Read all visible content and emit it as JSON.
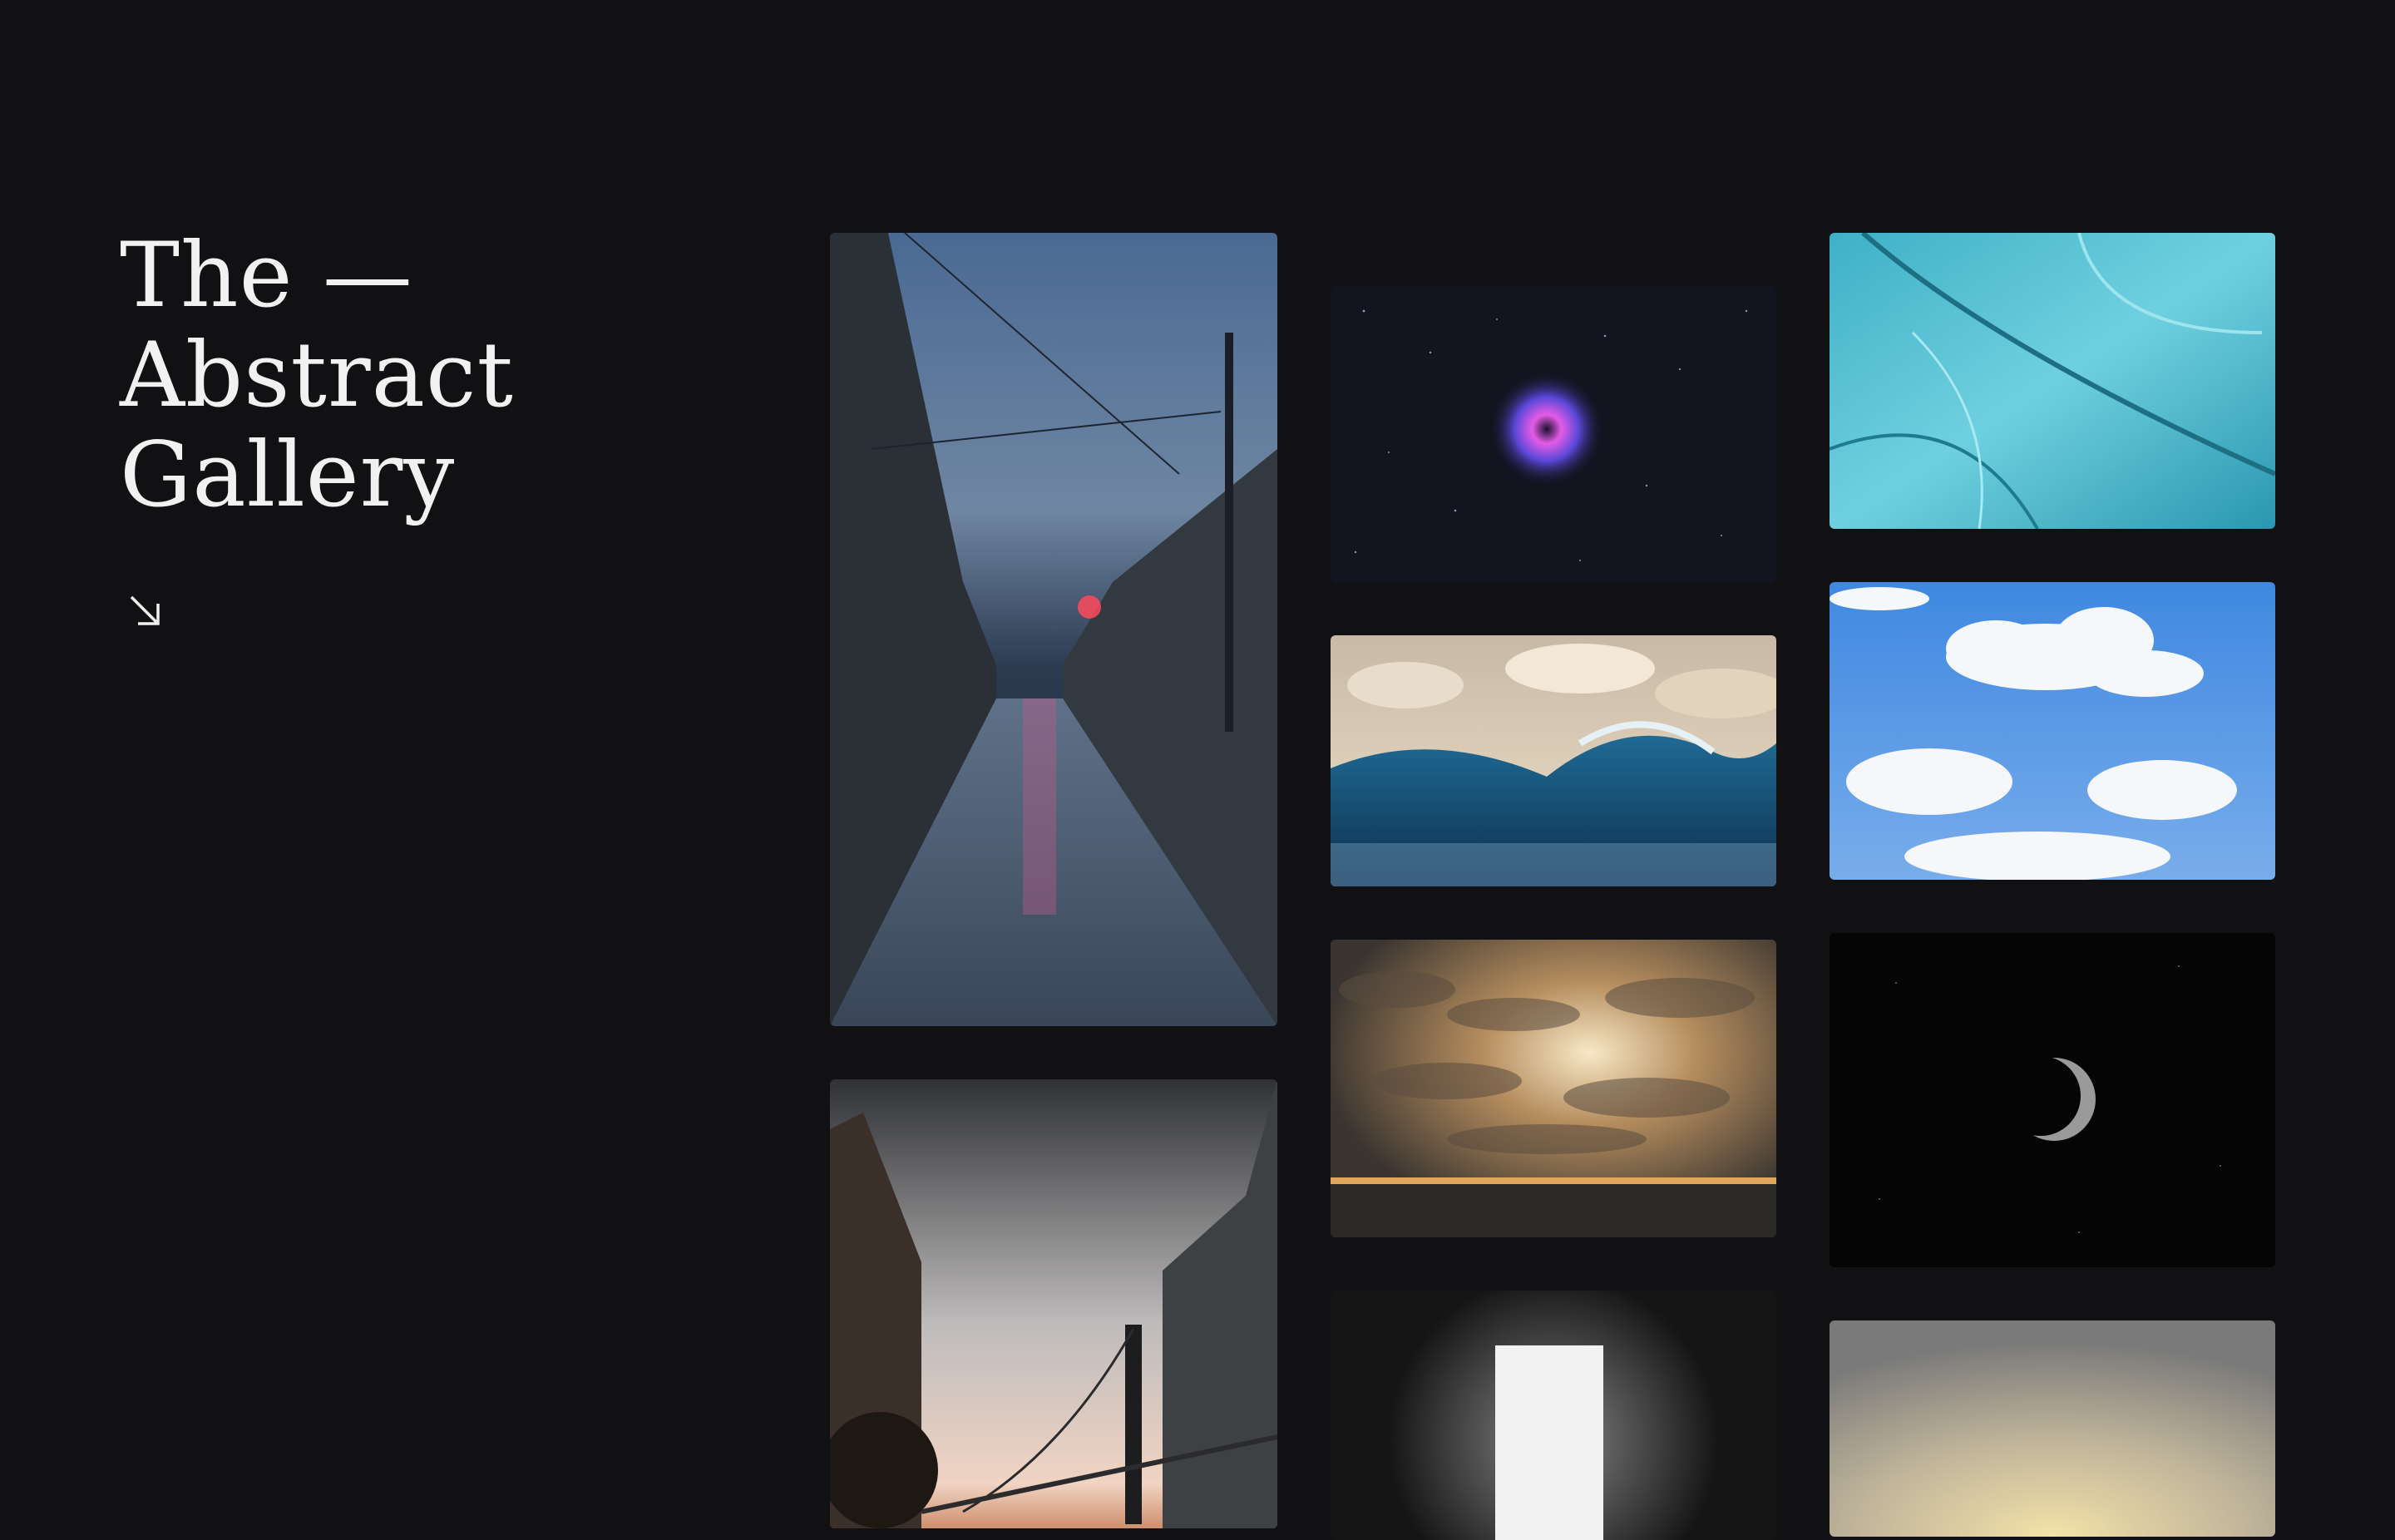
{
  "gallery": {
    "title_lines": [
      "The —",
      "Abstract",
      "Gallery"
    ],
    "arrow_icon": "arrow-down-right-icon"
  },
  "images": [
    {
      "name": "alley-night",
      "description": "wet cobblestone alley at dusk with neon lights"
    },
    {
      "name": "nebula",
      "description": "purple nebula in starry sky"
    },
    {
      "name": "ice",
      "description": "cracked blue ice texture"
    },
    {
      "name": "wave",
      "description": "ocean wave under clouds"
    },
    {
      "name": "clouds",
      "description": "white clouds on blue sky"
    },
    {
      "name": "sunset-clouds",
      "description": "golden clouds over sea"
    },
    {
      "name": "crescent-moon",
      "description": "crescent moon in dark sky"
    },
    {
      "name": "bridge",
      "description": "bridge between buildings at sunset"
    },
    {
      "name": "doorway",
      "description": "bright doorway in dark room"
    },
    {
      "name": "glow",
      "description": "soft golden glow"
    }
  ]
}
